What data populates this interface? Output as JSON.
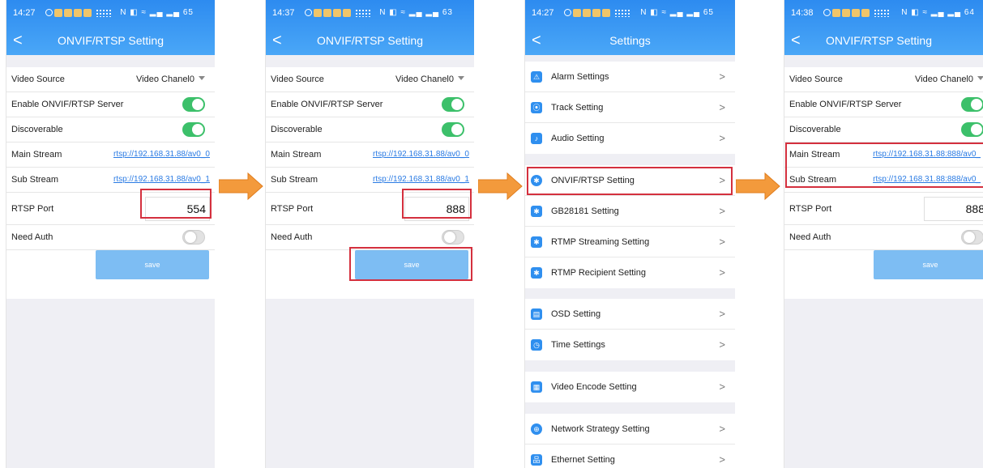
{
  "screens": [
    {
      "time": "14:27",
      "status_right": "N ◧ ≈ ▂▄ ▂▄ 65",
      "title": "ONVIF/RTSP Setting",
      "video_source_label": "Video Source",
      "video_source_value": "Video Chanel0",
      "enable_label": "Enable ONVIF/RTSP Server",
      "discoverable_label": "Discoverable",
      "main_stream_label": "Main Stream",
      "main_stream_url": "rtsp://192.168.31.88/av0_0",
      "sub_stream_label": "Sub Stream",
      "sub_stream_url": "rtsp://192.168.31.88/av0_1",
      "rtsp_port_label": "RTSP Port",
      "rtsp_port_value": "554",
      "need_auth_label": "Need Auth",
      "save_label": "save"
    },
    {
      "time": "14:37",
      "status_right": "N ◧ ≈ ▂▄ ▂▄ 63",
      "title": "ONVIF/RTSP Setting",
      "video_source_label": "Video Source",
      "video_source_value": "Video Chanel0",
      "enable_label": "Enable ONVIF/RTSP Server",
      "discoverable_label": "Discoverable",
      "main_stream_label": "Main Stream",
      "main_stream_url": "rtsp://192.168.31.88/av0_0",
      "sub_stream_label": "Sub Stream",
      "sub_stream_url": "rtsp://192.168.31.88/av0_1",
      "rtsp_port_label": "RTSP Port",
      "rtsp_port_value": "888",
      "need_auth_label": "Need Auth",
      "save_label": "save"
    },
    {
      "time": "14:27",
      "status_right": "N ◧ ≈ ▂▄ ▂▄ 65",
      "title": "Settings",
      "items": [
        "Alarm Settings",
        "Track Setting",
        "Audio Setting",
        "ONVIF/RTSP Setting",
        "GB28181 Setting",
        "RTMP Streaming Setting",
        "RTMP Recipient Setting",
        "OSD Setting",
        "Time Settings",
        "Video Encode Setting",
        "Network Strategy Setting",
        "Ethernet Setting"
      ]
    },
    {
      "time": "14:38",
      "status_right": "N ◧ ≈ ▂▄ ▂▄ 64",
      "title": "ONVIF/RTSP Setting",
      "video_source_label": "Video Source",
      "video_source_value": "Video Chanel0",
      "enable_label": "Enable ONVIF/RTSP Server",
      "discoverable_label": "Discoverable",
      "main_stream_label": "Main Stream",
      "main_stream_url": "rtsp://192.168.31.88:888/av0_",
      "sub_stream_label": "Sub Stream",
      "sub_stream_url": "rtsp://192.168.31.88:888/av0_",
      "rtsp_port_label": "RTSP Port",
      "rtsp_port_value": "888",
      "need_auth_label": "Need Auth",
      "save_label": "save"
    }
  ],
  "colors": {
    "header": "#2d8bf0",
    "toggle_on": "#3cc06a",
    "save_button": "#7dbdf3",
    "highlight": "#d4303e",
    "arrow": "#f39a3c"
  }
}
